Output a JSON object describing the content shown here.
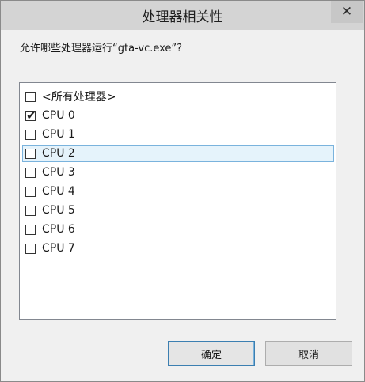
{
  "window": {
    "title": "处理器相关性",
    "close_glyph": "✕"
  },
  "prompt": "允许哪些处理器运行“gta-vc.exe”?",
  "list": {
    "items": [
      {
        "label": "<所有处理器>",
        "checked": false
      },
      {
        "label": "CPU 0",
        "checked": true
      },
      {
        "label": "CPU 1",
        "checked": false
      },
      {
        "label": "CPU 2",
        "checked": false,
        "highlighted": true
      },
      {
        "label": "CPU 3",
        "checked": false
      },
      {
        "label": "CPU 4",
        "checked": false
      },
      {
        "label": "CPU 5",
        "checked": false
      },
      {
        "label": "CPU 6",
        "checked": false
      },
      {
        "label": "CPU 7",
        "checked": false
      }
    ]
  },
  "buttons": {
    "ok_label": "确定",
    "cancel_label": "取消"
  },
  "colors": {
    "titlebar": "#d4d4d4",
    "highlight": "#e5f3fb",
    "highlight_border": "#7ab3dd",
    "default_button_border": "#3c7fb1"
  }
}
